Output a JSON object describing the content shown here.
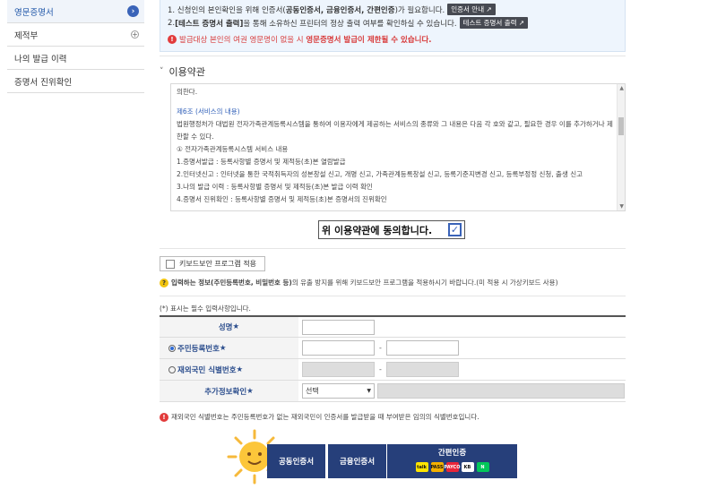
{
  "sidebar": {
    "items": [
      {
        "label": "영문증명서"
      },
      {
        "label": "제적부"
      },
      {
        "label": "나의 발급 이력"
      },
      {
        "label": "증명서 진위확인"
      }
    ]
  },
  "notice": {
    "line1_pre": "1. 신청인의 본인확인을 위해 인증서(",
    "line1_bold": "공동인증서, 금융인증서, 간편인증",
    "line1_post": ")가 필요합니다.",
    "line1_btn": "인증서 안내",
    "line2_pre": "2.",
    "line2_bold": "[테스트 증명서 출력]",
    "line2_post": "을 통해 소유하신 프린터의 정상 출력 여부를 확인하실 수 있습니다.",
    "line2_btn": "테스트 증명서 출력",
    "warn_pre": "발급대상 본인의 여권 영문명이 없을 시",
    "warn_bold": "영문증명서 발급이 제한될 수 있습니다."
  },
  "terms": {
    "title": "이용약관",
    "lines": [
      "의한다.",
      "",
      "제6조 (서비스의 내용)",
      "법원행정처가 대법원 전자가족관계등록시스템을 통하여 이용자에게 제공하는 서비스의 종류와 그 내용은 다음 각 호와 같고, 필요한 경우 이를 추가하거나 제",
      "한할 수 있다.",
      "① 전자가족관계등록시스템 서비스 내용",
      "1.증명서발급 : 등록사항별 증명서 및 제적등(초)본 열람발급",
      "2.인터넷신고 : 인터넷을 통한 국적취득자의 성본창설 신고, 개명 신고, 가족관계등록창설 신고, 등록기준지변경 신고, 등록부정정 신청, 출생 신고",
      "3.나의 발급 이력 : 등록사항별 증명서 및 제적등(초)본 발급 이력 확인",
      "4.증명서 진위확인 : 등록사항별 증명서 및 제적등(초)본 증명서의 진위확인"
    ],
    "agree_label": "위 이용약관에 동의합니다."
  },
  "keyboard": {
    "label": "키보드보안 프로그램 적용",
    "info_bold": "입력하는 정보(주민등록번호, 비밀번호 등)",
    "info_post": "의 유출 방지를 위해 키보드보안 프로그램을 적용하시기 바랍니다.(미 적용 시 가상키보드 사용)"
  },
  "form": {
    "required_note": "(*) 표시는 필수 입력사항입니다.",
    "name_label": "성명",
    "rrn_label": "주민등록번호",
    "foreign_label": "재외국민 식별번호",
    "extra_label": "추가정보확인",
    "required_mark": "★",
    "select_value": "선택",
    "dash": "-"
  },
  "footnote": "재외국민 식별번호는 주민등록번호가 없는 재외국민이 인증서를 발급받을 때 부여받은 임의의 식별번호입니다.",
  "auth": {
    "joint": "공동인증서",
    "finance": "금융인증서",
    "simple": "간편인증",
    "simple_logos": [
      {
        "name": "kakao",
        "text": "talk",
        "color": "#fee500"
      },
      {
        "name": "pass",
        "text": "PASS",
        "color": "#f4b000"
      },
      {
        "name": "payco",
        "text": "PAYCO",
        "color": "#e8253a"
      },
      {
        "name": "kb",
        "text": "KB",
        "color": "#ffffff"
      },
      {
        "name": "naver",
        "text": "N",
        "color": "#03c75a"
      }
    ]
  },
  "colors": {
    "accent": "#263f7a",
    "link": "#2f5fb8",
    "warn": "#d83b3b"
  }
}
